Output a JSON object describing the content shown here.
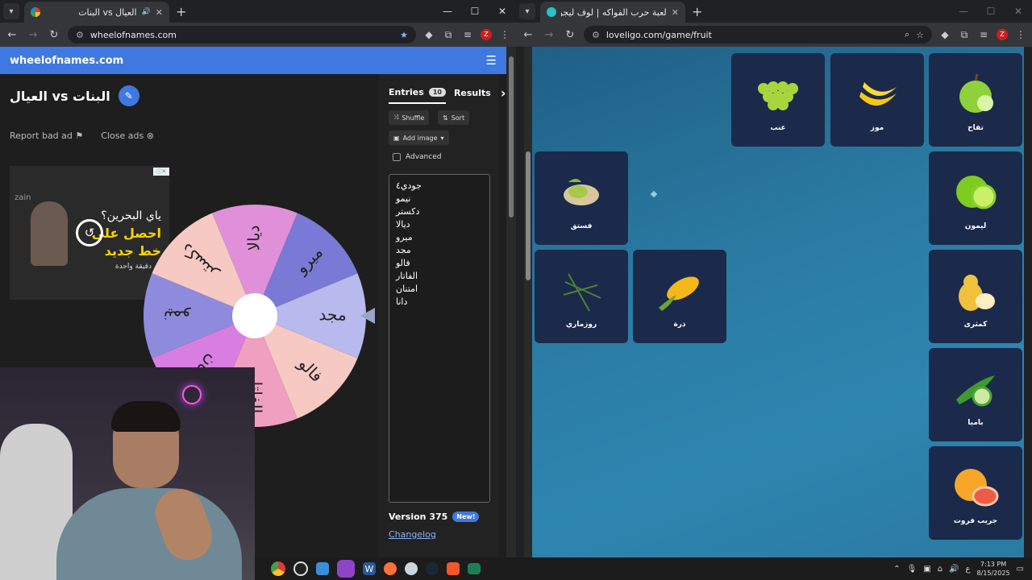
{
  "left_window": {
    "tab_title": "العيال vs البنات",
    "url": "wheelofnames.com",
    "brand": "wheelofnames.com",
    "wheel_title": "البنات vs العيال",
    "report_ad": "Report bad ad",
    "close_ads": "Close ads",
    "ad": {
      "brand": "zain",
      "line1": "ياي البحرين؟",
      "line2": "احصل على",
      "line3": "خط جديد",
      "line4": "دقيقة واحدة"
    },
    "tabs": {
      "entries_label": "Entries",
      "entries_count": "10",
      "results_label": "Results"
    },
    "buttons": {
      "shuffle": "Shuffle",
      "sort": "Sort",
      "add_image": "Add image",
      "advanced": "Advanced"
    },
    "entries": [
      "جودي٤",
      "نيمو",
      "دكستر",
      "ديالا",
      "ميرو",
      "مجد",
      "فالو",
      "الفاتار",
      "امتنان",
      "دانا"
    ],
    "version": "Version 375",
    "new_badge": "New!",
    "changelog": "Changelog",
    "wheel_labels": [
      "مجد",
      "فالو",
      "الفاتار",
      "امتنان",
      "نيمو",
      "دكستر",
      "ديالا",
      "ميرو"
    ],
    "wheel_colors": [
      "#b8b9ec",
      "#f6c9c2",
      "#ef9fbf",
      "#d87ee0",
      "#8f8bdc",
      "#f6c9c2",
      "#e090d8",
      "#7b79d6"
    ]
  },
  "right_window": {
    "tab_title": "لعبة حرب الفواكه | لوف ليجو يوح",
    "url": "loveligo.com/game/fruit",
    "cards": [
      {
        "label": "تفاح",
        "icon": "apple-icon"
      },
      {
        "label": "موز",
        "icon": "banana-icon"
      },
      {
        "label": "عنب",
        "icon": "grapes-icon"
      },
      {
        "label": "ليمون",
        "icon": "lime-icon"
      },
      {
        "label": "فستق",
        "icon": "pistachio-icon"
      },
      {
        "label": "كمثرى",
        "icon": "pear-icon"
      },
      {
        "label": "ذرة",
        "icon": "corn-icon"
      },
      {
        "label": "روزماري",
        "icon": "rosemary-icon"
      },
      {
        "label": "باميا",
        "icon": "okra-icon"
      },
      {
        "label": "جريب فروت",
        "icon": "grapefruit-icon"
      }
    ]
  },
  "taskbar": {
    "time": "7:13 PM",
    "date": "8/15/2025",
    "lang": "ع"
  }
}
